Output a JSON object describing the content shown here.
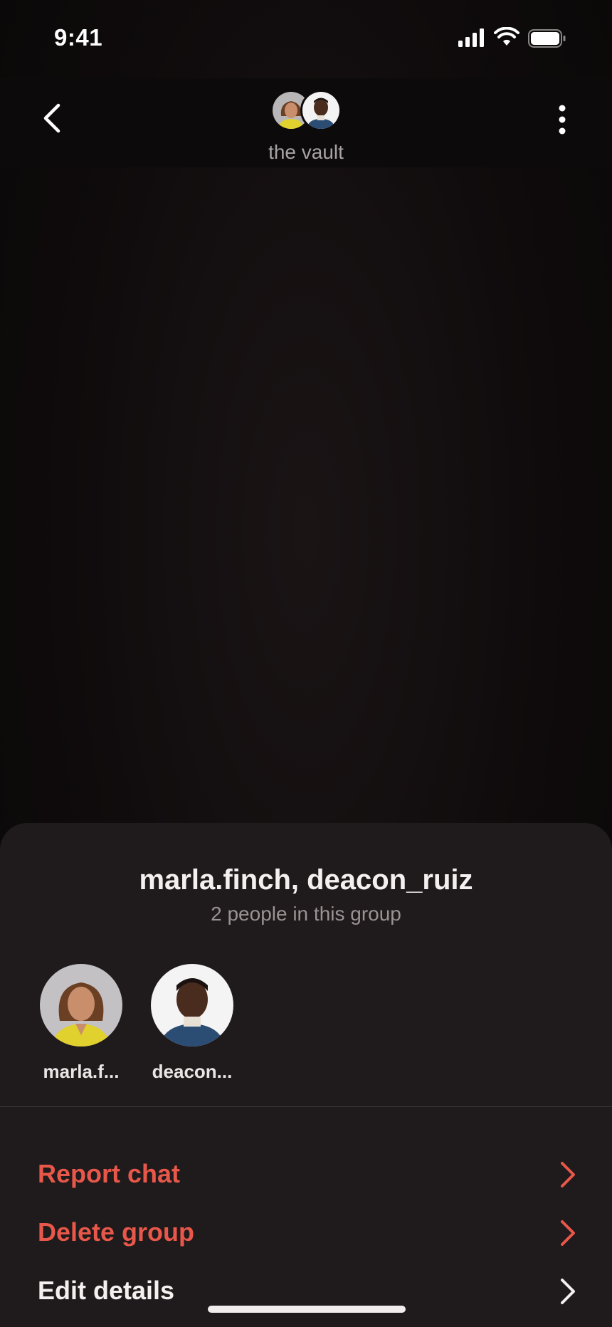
{
  "status_bar": {
    "time": "9:41"
  },
  "header": {
    "title": "the vault"
  },
  "sheet": {
    "title": "marla.finch, deacon_ruiz",
    "subtitle": "2 people in this group",
    "members": [
      {
        "name": "marla.f..."
      },
      {
        "name": "deacon..."
      }
    ],
    "actions": [
      {
        "label": "Report chat",
        "style": "danger"
      },
      {
        "label": "Delete group",
        "style": "danger"
      },
      {
        "label": "Edit details",
        "style": "normal"
      }
    ]
  },
  "colors": {
    "danger": "#e8584a",
    "sheet_bg": "#1f1a1b",
    "background": "#0d0a0b"
  },
  "icons": [
    "back-chevron-icon",
    "more-vertical-icon",
    "signal-icon",
    "wifi-icon",
    "battery-icon",
    "chevron-right-icon"
  ]
}
